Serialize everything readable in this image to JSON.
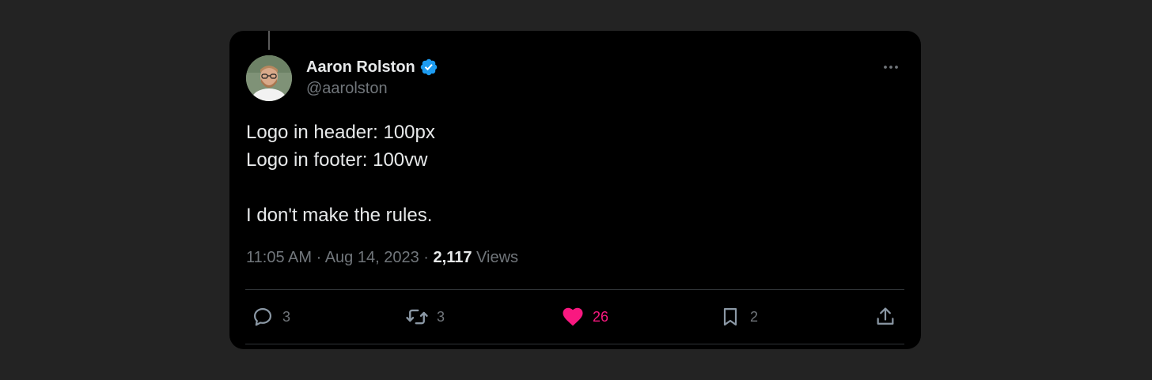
{
  "tweet": {
    "author": {
      "display_name": "Aaron Rolston",
      "handle": "@aarolston",
      "verified": true
    },
    "text_lines": [
      "Logo in header: 100px",
      "Logo in footer: 100vw",
      "",
      "I don't make the rules."
    ],
    "time": "11:05 AM",
    "date": "Aug 14, 2023",
    "separator": "·",
    "views_count": "2,117",
    "views_label": "Views"
  },
  "actions": {
    "reply": {
      "icon": "reply-icon",
      "count": "3"
    },
    "retweet": {
      "icon": "retweet-icon",
      "count": "3"
    },
    "like": {
      "icon": "heart-icon",
      "count": "26",
      "active": true
    },
    "bookmark": {
      "icon": "bookmark-icon",
      "count": "2"
    },
    "share": {
      "icon": "share-icon"
    }
  },
  "colors": {
    "page_background": "#232323",
    "card_background": "#000000",
    "primary_text": "#e7e9ea",
    "secondary_text": "#71767b",
    "verified_blue": "#1d9bf0",
    "like_pink": "#f91880",
    "divider": "#2f3336"
  }
}
